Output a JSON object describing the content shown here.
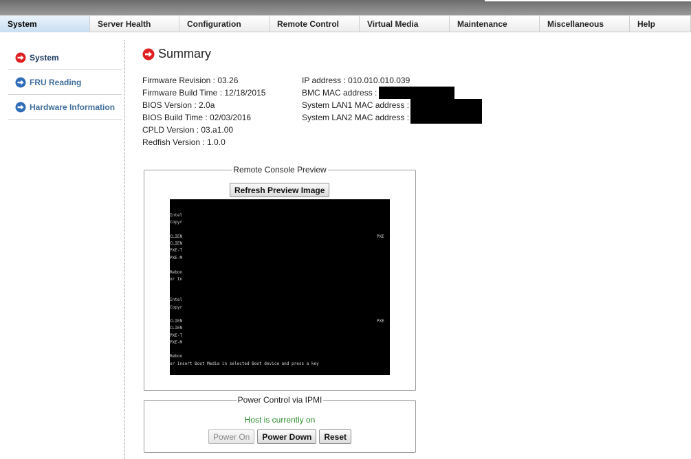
{
  "nav": {
    "items": [
      {
        "label": "System",
        "width": 131
      },
      {
        "label": "Server Health",
        "width": 130
      },
      {
        "label": "Configuration",
        "width": 131
      },
      {
        "label": "Remote Control",
        "width": 131
      },
      {
        "label": "Virtual Media",
        "width": 131
      },
      {
        "label": "Maintenance",
        "width": 131
      },
      {
        "label": "Miscellaneous",
        "width": 131
      },
      {
        "label": "Help",
        "width": 89
      }
    ],
    "active": "System"
  },
  "sidebar": {
    "items": [
      {
        "label": "System",
        "icon": "arrow-right-circle-red-icon",
        "color": "#e02020"
      },
      {
        "label": "FRU Reading",
        "icon": "arrow-right-circle-blue-icon",
        "color": "#2f6cb8"
      },
      {
        "label": "Hardware Information",
        "icon": "arrow-right-circle-blue-icon",
        "color": "#2f6cb8"
      }
    ]
  },
  "summary": {
    "title": "Summary",
    "left": [
      "Firmware Revision :  03.26",
      "Firmware Build Time :  12/18/2015",
      "BIOS Version : 2.0a",
      "BIOS Build Time : 02/03/2016",
      "CPLD Version : 03.a1.00",
      "Redfish Version : 1.0.0"
    ],
    "right": [
      "IP address :  010.010.010.039",
      "BMC MAC address :",
      "System LAN1 MAC address :",
      "System LAN2 MAC address :"
    ]
  },
  "preview": {
    "legend": "Remote Console Preview",
    "refresh_label": "Refresh Preview Image",
    "console_lines": [
      "Intel",
      "Copyr",
      "CLIEN",
      "CLIEN",
      "PXE-T",
      "PXE-M",
      "Reboo",
      "or In",
      "Intel",
      "Copyr",
      "CLIEN",
      "CLIEN",
      "PXE-T",
      "PXE-M",
      "Reboo",
      "or Insert Boot Media in selected Boot device and press a key"
    ],
    "console_side": [
      "PXE",
      "PXE"
    ]
  },
  "power": {
    "legend": "Power Control via IPMI",
    "status": "Host is currently on",
    "status_color": "#2e8b2e",
    "power_on_label": "Power On",
    "power_down_label": "Power Down",
    "reset_label": "Reset"
  }
}
